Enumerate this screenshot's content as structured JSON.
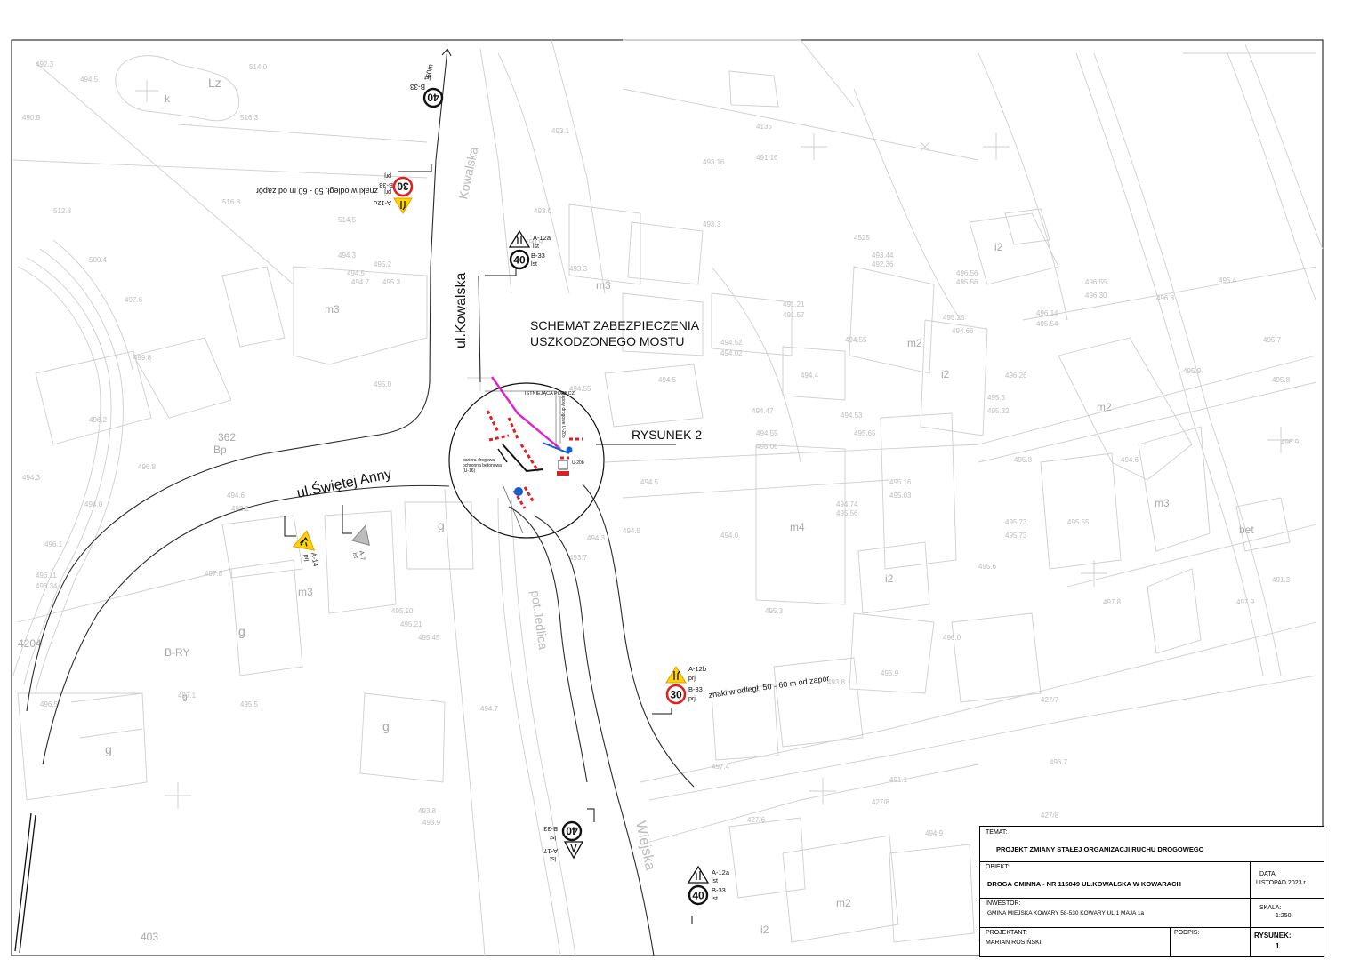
{
  "drawing": {
    "scheme_title_line1": "SCHEMAT ZABEZPIECZENIA",
    "scheme_title_line2": "USZKODZONEGO MOSTU",
    "detail_reference": "RYSUNEK 2",
    "streets": {
      "kowalska": "ul.Kowalska",
      "swietej_anny": "ul.Świętej Anny",
      "kowalska_faint": "Kowalska",
      "wiejska_faint": "Wiejska",
      "potok": "pot.Jedlica"
    },
    "inset_labels": {
      "existing_railing": "ISTNIEJĄCA PORĘCZ",
      "barrier_note_1": "bariera drogowa",
      "barrier_note_2": "ochronna betonowa",
      "barrier_note_3": "(U-16)",
      "vertical_note": "zapory drogowe U-20b",
      "u20b": "U-20b"
    }
  },
  "signs": [
    {
      "id": "top",
      "codes": [
        "B-33"
      ],
      "speed": "40",
      "suffix": "lst",
      "distance": "60m"
    },
    {
      "id": "upper-left",
      "codes": [
        "A-12c",
        "B-33"
      ],
      "speed": "30",
      "suffix": "prj",
      "note": "znaki w odległ. 50 - 60 m od zapór"
    },
    {
      "id": "upper-center",
      "codes": [
        "A-12a",
        "B-33"
      ],
      "speed": "40",
      "suffix": "lst"
    },
    {
      "id": "left-roadworks",
      "codes": [
        "A-14"
      ],
      "suffix": "prj"
    },
    {
      "id": "left-warning",
      "codes": [
        "A-7"
      ],
      "suffix": "lst"
    },
    {
      "id": "lower-right",
      "codes": [
        "A-12b",
        "B-33"
      ],
      "speed": "30",
      "suffix": "prj",
      "note": "znaki w odległ. 50 - 60 m od zapór"
    },
    {
      "id": "bottom-center",
      "codes": [
        "B-33",
        "A-17"
      ],
      "speed": "40",
      "suffix": "lst"
    },
    {
      "id": "bottom-right",
      "codes": [
        "A-12a",
        "B-33"
      ],
      "speed": "40",
      "suffix": "lst"
    }
  ],
  "sign_text": {
    "top_b33": "B-33",
    "top_lst": "lst",
    "top_dist": "60m",
    "ul_note": "znaki w odległ. 50 - 60 m od zapór",
    "ul_a12c": "A-12c",
    "ul_b33": "B-33",
    "ul_prj": "prj",
    "ul_prj2": "prj",
    "uc_a12a": "A-12a",
    "uc_lst": "lst",
    "uc_b33": "B-33",
    "uc_lst2": "lst",
    "l_a14": "A-14",
    "l_prj": "prj",
    "l_a7": "A-7",
    "l_lst": "lst",
    "lr_a12b": "A-12b",
    "lr_prj": "prj",
    "lr_b33": "B-33",
    "lr_prj2": "prj",
    "lr_note": "znaki w odległ. 50 - 60 m od zapór",
    "bc_b33": "B-33",
    "bc_lst": "lst",
    "bc_a17": "A-17",
    "bc_lst2": "lst",
    "br_a12a": "A-12a",
    "br_lst": "lst",
    "br_b33": "B-33",
    "br_lst2": "lst",
    "speed_40": "40",
    "speed_30": "30"
  },
  "map_labels": {
    "lz": "Lz",
    "k1": "k",
    "m3a": "m3",
    "m3b": "m3",
    "m3c": "m3",
    "m3d": "m3",
    "m2a": "m2",
    "m2b": "m2",
    "m2c": "m2",
    "m4": "m4",
    "i2a": "i2",
    "i2b": "i2",
    "i2c": "i2",
    "i2d": "i2",
    "g1": "g",
    "g2": "g",
    "g3": "g",
    "g4": "g",
    "g5": "g",
    "bp": "Bp",
    "bry": "B-RY",
    "bet": "bet",
    "n362": "362",
    "n403": "403",
    "n4204": "4204"
  },
  "title_block": {
    "temat_label": "TEMAT:",
    "temat_value": "PROJEKT ZMIANY STAŁEJ ORGANIZACJI RUCHU DROGOWEGO",
    "obiekt_label": "OBIEKT:",
    "obiekt_value": "DROGA GMINNA - NR 115849 UL.KOWALSKA W KOWARACH",
    "data_label": "DATA:",
    "data_value": "LISTOPAD  2023 r.",
    "inwestor_label": "INWESTOR:",
    "inwestor_value": "GMINA MIEJSKA KOWARY  58-530 KOWARY UL.1 MAJA 1a",
    "skala_label": "SKALA:",
    "skala_value": "1:250",
    "projektant_label": "PROJEKTANT:",
    "projektant_value": "MARIAN ROSIŃSKI",
    "podpis_label": "PODPIS:",
    "rysunek_label": "RYSUNEK:",
    "rysunek_value": "1"
  },
  "colors": {
    "basemap": "#c8c8c8",
    "road": "#222222",
    "railing": "#e020d0",
    "barrier": "#e02020",
    "warning_yellow": "#ffd400",
    "info_blue": "#1060d0"
  }
}
